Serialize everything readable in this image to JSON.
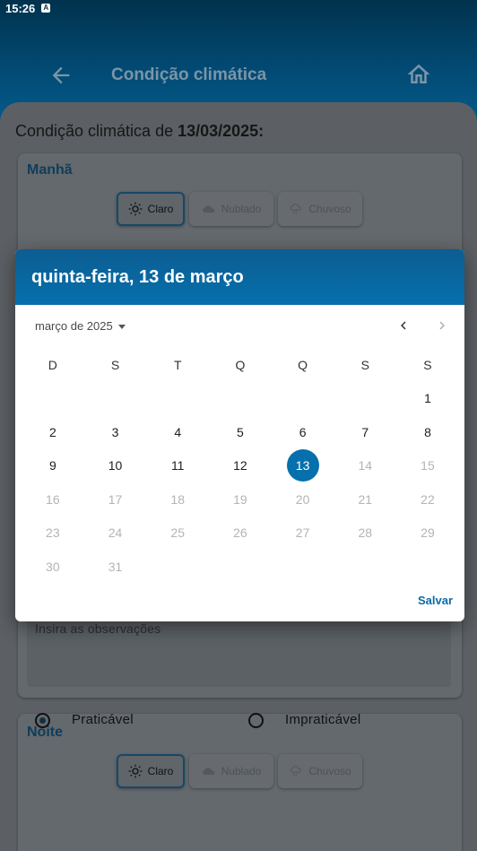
{
  "status_bar": {
    "time": "15:26",
    "indicator": "A"
  },
  "app_bar": {
    "title": "Condição climática"
  },
  "page": {
    "heading_prefix": "Condição climática de ",
    "heading_date": "13/03/2025:"
  },
  "morning_card": {
    "title": "Manhã",
    "options": [
      {
        "label": "Claro",
        "icon": "sun-icon",
        "selected": true
      },
      {
        "label": "Nublado",
        "icon": "cloud-icon",
        "selected": false
      },
      {
        "label": "Chuvoso",
        "icon": "rain-icon",
        "selected": false
      }
    ]
  },
  "observations": {
    "placeholder": "Insira as observações"
  },
  "night_card": {
    "title": "Noite",
    "options": [
      {
        "label": "Claro",
        "icon": "sun-icon",
        "selected": true
      },
      {
        "label": "Nublado",
        "icon": "cloud-icon",
        "selected": false
      },
      {
        "label": "Chuvoso",
        "icon": "rain-icon",
        "selected": false
      }
    ]
  },
  "practicability": {
    "options": [
      {
        "label": "Praticável",
        "selected": true
      },
      {
        "label": "Impraticável",
        "selected": false
      }
    ]
  },
  "date_picker": {
    "headline": "quinta-feira, 13 de março",
    "month_label": "março de 2025",
    "weekdays": [
      "D",
      "S",
      "T",
      "Q",
      "Q",
      "S",
      "S"
    ],
    "weeks": [
      [
        "",
        "",
        "",
        "",
        "",
        "",
        "1"
      ],
      [
        "2",
        "3",
        "4",
        "5",
        "6",
        "7",
        "8"
      ],
      [
        "9",
        "10",
        "11",
        "12",
        "13",
        "14",
        "15"
      ],
      [
        "16",
        "17",
        "18",
        "19",
        "20",
        "21",
        "22"
      ],
      [
        "23",
        "24",
        "25",
        "26",
        "27",
        "28",
        "29"
      ],
      [
        "30",
        "31",
        "",
        "",
        "",
        "",
        ""
      ]
    ],
    "selected_day": "13",
    "last_enabled_day": 13,
    "save_label": "Salvar"
  },
  "colors": {
    "primary": "#0670ad",
    "header_dark": "#01324d",
    "disabled_text": "#b4b4b4"
  }
}
